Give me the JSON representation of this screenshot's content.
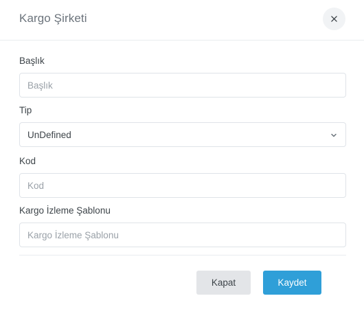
{
  "modal": {
    "title": "Kargo Şirketi",
    "close_icon": "close-icon"
  },
  "form": {
    "baslik": {
      "label": "Başlık",
      "placeholder": "Başlık",
      "value": ""
    },
    "tip": {
      "label": "Tip",
      "selected": "UnDefined",
      "icon": "chevron-down-icon"
    },
    "kod": {
      "label": "Kod",
      "placeholder": "Kod",
      "value": ""
    },
    "sablon": {
      "label": "Kargo İzleme Şablonu",
      "placeholder": "Kargo İzleme Şablonu",
      "value": ""
    }
  },
  "footer": {
    "close_label": "Kapat",
    "save_label": "Kaydet"
  },
  "colors": {
    "primary": "#2f9fd8",
    "secondary": "#e3e5e8",
    "border": "#dfe3e8",
    "title": "#6b737b"
  }
}
